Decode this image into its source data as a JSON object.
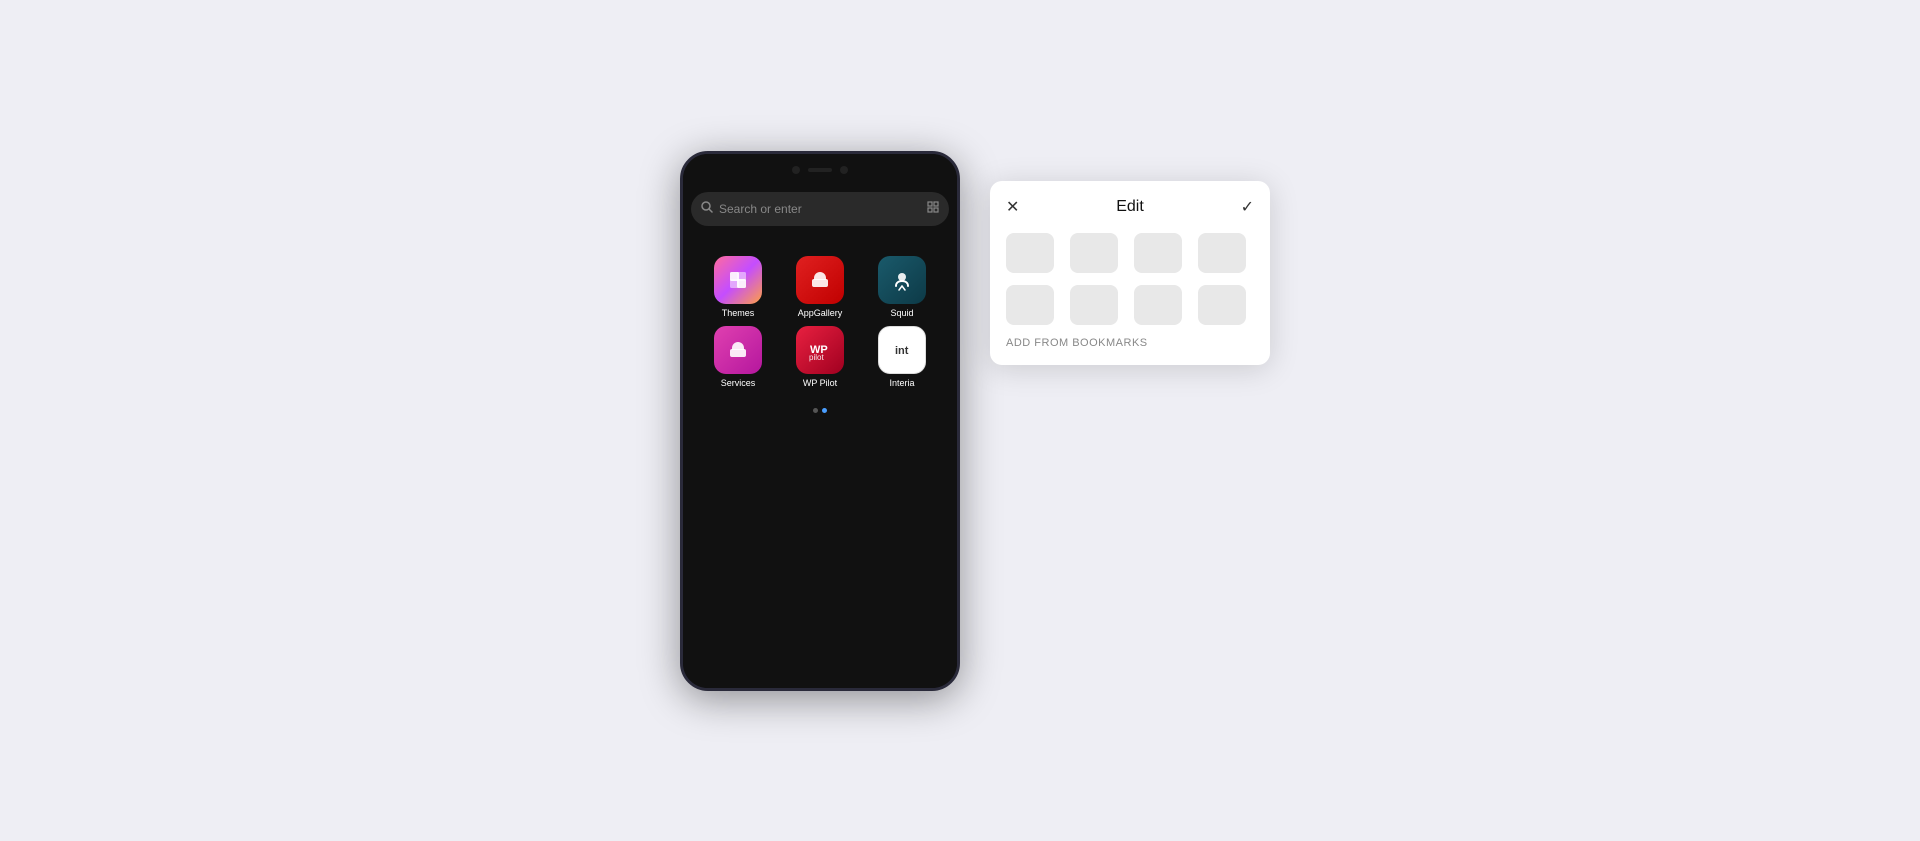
{
  "background_color": "#eeeef4",
  "phone": {
    "search_placeholder": "Search or enter",
    "apps": [
      {
        "id": "themes",
        "label": "Themes",
        "icon_class": "icon-themes",
        "icon_char": "🎨"
      },
      {
        "id": "appgallery",
        "label": "AppGallery",
        "icon_class": "icon-appgallery",
        "icon_char": "⊕"
      },
      {
        "id": "squid",
        "label": "Squid",
        "icon_class": "icon-squid",
        "icon_char": "✏"
      },
      {
        "id": "services",
        "label": "Services",
        "icon_class": "icon-services",
        "icon_char": "⊕"
      },
      {
        "id": "wppilot",
        "label": "WP Pilot",
        "icon_class": "icon-wppilot",
        "icon_char": "▶"
      },
      {
        "id": "interia",
        "label": "Interia",
        "icon_class": "icon-interia",
        "icon_char": "in"
      }
    ],
    "dots": [
      "dot",
      "dot active"
    ]
  },
  "edit_panel": {
    "title": "Edit",
    "close_icon": "×",
    "confirm_icon": "✓",
    "add_from_bookmarks_label": "ADD FROM BOOKMARKS",
    "bookmark_rows": [
      [
        true,
        true,
        true,
        true
      ],
      [
        true,
        true,
        true,
        true
      ]
    ]
  }
}
